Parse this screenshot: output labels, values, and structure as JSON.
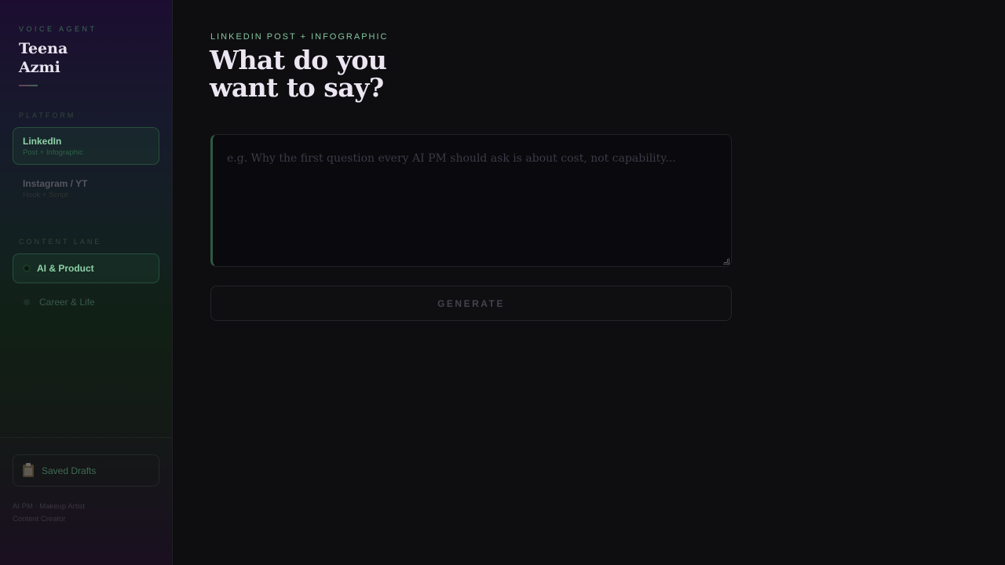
{
  "sidebar": {
    "eyebrow": "VOICE AGENT",
    "name_line1": "Teena",
    "name_line2": "Azmi",
    "platform_label": "PLATFORM",
    "platforms": [
      {
        "title": "LinkedIn",
        "subtitle": "Post + Infographic",
        "active": true
      },
      {
        "title": "Instagram / YT",
        "subtitle": "Hook + Script",
        "active": false
      }
    ],
    "lane_label": "CONTENT LANE",
    "lanes": [
      {
        "label": "AI & Product",
        "active": true
      },
      {
        "label": "Career & Life",
        "active": false
      }
    ],
    "drafts_label": "Saved Drafts",
    "drafts_icon": "clipboard-icon",
    "footer_line1": "AI PM · Makeup Artist",
    "footer_line2": "Content Creator"
  },
  "main": {
    "eyebrow": "LINKEDIN POST + INFOGRAPHIC",
    "headline_line1": "What do you",
    "headline_line2": "want to say?",
    "prompt_placeholder": "e.g. Why the first question every AI PM should ask is about cost, not capability...",
    "prompt_value": "",
    "generate_label": "GENERATE"
  },
  "colors": {
    "accent_green": "#8fd1a8",
    "background": "#0e0e10",
    "headline": "#ece6f2"
  }
}
